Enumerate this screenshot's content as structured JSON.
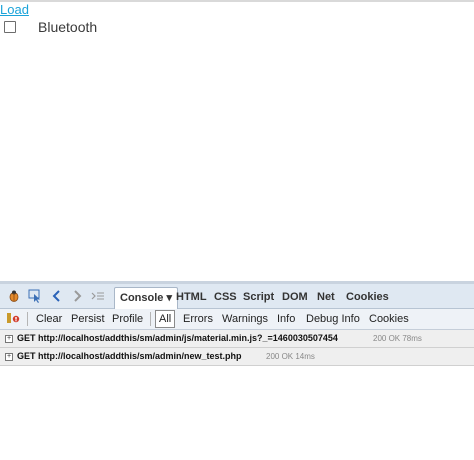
{
  "page": {
    "load_link": "Load",
    "bluetooth_label": "Bluetooth"
  },
  "firebug": {
    "tabs": [
      {
        "label": "Console ▾"
      },
      {
        "label": "HTML"
      },
      {
        "label": "CSS"
      },
      {
        "label": "Script"
      },
      {
        "label": "DOM"
      },
      {
        "label": "Net"
      },
      {
        "label": "Cookies"
      }
    ],
    "subbar": {
      "clear": "Clear",
      "persist": "Persist",
      "profile": "Profile",
      "filters": [
        "All",
        "Errors",
        "Warnings",
        "Info",
        "Debug Info",
        "Cookies"
      ]
    },
    "log": [
      {
        "request": "GET http://localhost/addthis/sm/admin/js/material.min.js?_=1460030507454",
        "status": "200 OK 78ms"
      },
      {
        "request": "GET http://localhost/addthis/sm/admin/new_test.php",
        "status": "200 OK 14ms"
      }
    ]
  }
}
